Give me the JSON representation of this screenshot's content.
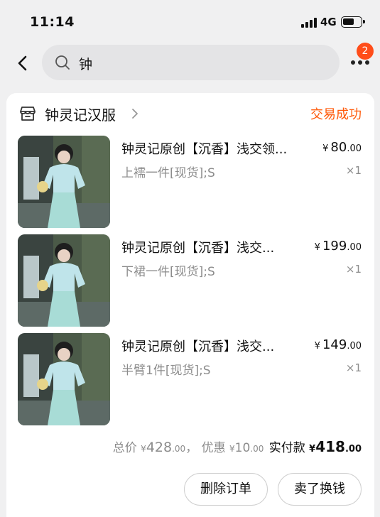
{
  "status_bar": {
    "time": "11:14",
    "network": "4G"
  },
  "search": {
    "query": "钟"
  },
  "header": {
    "badge_count": "2"
  },
  "store": {
    "name": "钟灵记汉服",
    "order_status": "交易成功"
  },
  "items": [
    {
      "title": "钟灵记原创【沉香】浅交领...",
      "spec": "上襦一件[现货];S",
      "currency": "¥",
      "price_int": "80",
      "price_dec": ".00",
      "qty": "×1"
    },
    {
      "title": "钟灵记原创【沉香】浅交...",
      "spec": "下裙一件[现货];S",
      "currency": "¥",
      "price_int": "199",
      "price_dec": ".00",
      "qty": "×1"
    },
    {
      "title": "钟灵记原创【沉香】浅交...",
      "spec": "半臂1件[现货];S",
      "currency": "¥",
      "price_int": "149",
      "price_dec": ".00",
      "qty": "×1"
    }
  ],
  "summary": {
    "total_label": "总价",
    "total_currency": "¥",
    "total_int": "428",
    "total_dec": ".00",
    "separator": "，",
    "discount_label": "优惠",
    "discount_currency": "¥",
    "discount_int": "10",
    "discount_dec": ".00",
    "paid_label": "实付款",
    "paid_currency": "¥",
    "paid_int": "418",
    "paid_dec": ".00"
  },
  "actions": {
    "delete_label": "删除订单",
    "resell_label": "卖了换钱"
  },
  "colors": {
    "accent": "#ff5a0a",
    "badge": "#ff4d1a",
    "muted": "#8c8c8c"
  }
}
